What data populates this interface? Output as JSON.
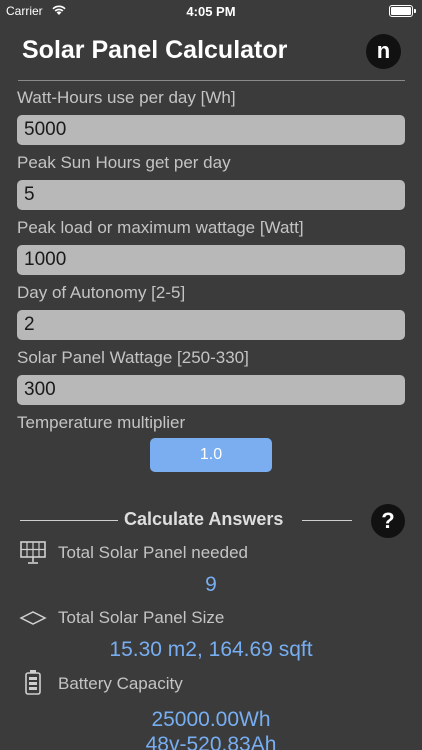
{
  "status_bar": {
    "carrier": "Carrier",
    "time": "4:05 PM"
  },
  "header": {
    "title": "Solar Panel Calculator",
    "badge": "n"
  },
  "form": {
    "wh_per_day": {
      "label": "Watt-Hours use per day [Wh]",
      "value": "5000"
    },
    "sun_hours": {
      "label": "Peak Sun Hours get per day",
      "value": "5"
    },
    "peak_load": {
      "label": "Peak load or maximum wattage [Watt]",
      "value": "1000"
    },
    "autonomy": {
      "label": "Day of Autonomy [2-5]",
      "value": "2"
    },
    "panel_wattage": {
      "label": "Solar Panel Wattage [250-330]",
      "value": "300"
    },
    "temperature": {
      "label": "Temperature multiplier",
      "value": "1.0"
    }
  },
  "results": {
    "section_title": "Calculate Answers",
    "help": "?",
    "panels_needed": {
      "label": "Total Solar Panel needed",
      "value": "9",
      "icon": "solar-panel-icon"
    },
    "panel_size": {
      "label": "Total Solar Panel Size",
      "value": "15.30 m2, 164.69 sqft",
      "icon": "area-diamond-icon"
    },
    "battery": {
      "label": "Battery Capacity",
      "value_wh": "25000.00Wh",
      "value_ah": "48v-520.83Ah",
      "icon": "battery-icon"
    }
  },
  "colors": {
    "background": "#3b3b3b",
    "input": "#b8b8b8",
    "accent": "#7aaef0",
    "result_text": "#77aef2"
  }
}
